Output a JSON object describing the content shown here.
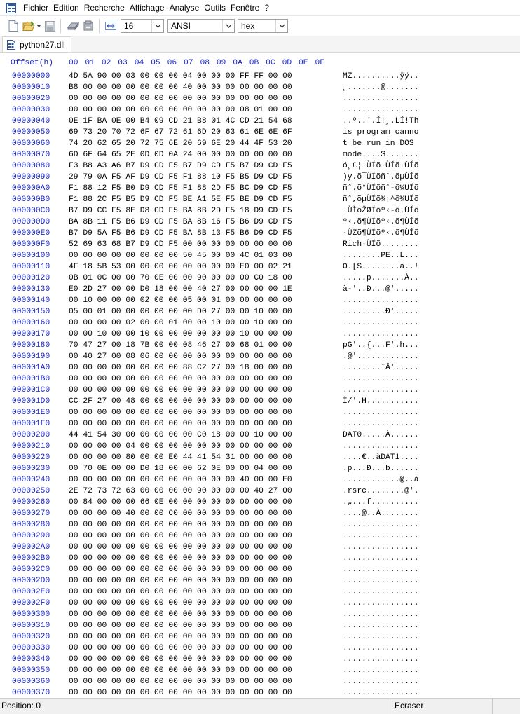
{
  "menu": [
    "Fichier",
    "Edition",
    "Recherche",
    "Affichage",
    "Analyse",
    "Outils",
    "Fenêtre",
    "?"
  ],
  "toolbar": {
    "bytes_per_row": "16",
    "charset": "ANSI",
    "display_mode": "hex"
  },
  "tab": {
    "label": "python27.dll"
  },
  "hexview": {
    "offset_label": "Offset(h)",
    "columns": [
      "00",
      "01",
      "02",
      "03",
      "04",
      "05",
      "06",
      "07",
      "08",
      "09",
      "0A",
      "0B",
      "0C",
      "0D",
      "0E",
      "0F"
    ],
    "rows": [
      {
        "off": "00000000",
        "hex": "4D 5A 90 00 03 00 00 00 04 00 00 00 FF FF 00 00",
        "asc": "MZ..........ÿÿ.."
      },
      {
        "off": "00000010",
        "hex": "B8 00 00 00 00 00 00 00 40 00 00 00 00 00 00 00",
        "asc": "¸.......@......."
      },
      {
        "off": "00000020",
        "hex": "00 00 00 00 00 00 00 00 00 00 00 00 00 00 00 00",
        "asc": "................"
      },
      {
        "off": "00000030",
        "hex": "00 00 00 00 00 00 00 00 00 00 00 00 08 01 00 00",
        "asc": "................"
      },
      {
        "off": "00000040",
        "hex": "0E 1F BA 0E 00 B4 09 CD 21 B8 01 4C CD 21 54 68",
        "asc": "..º..´.Í!¸.LÍ!Th"
      },
      {
        "off": "00000050",
        "hex": "69 73 20 70 72 6F 67 72 61 6D 20 63 61 6E 6E 6F",
        "asc": "is program canno"
      },
      {
        "off": "00000060",
        "hex": "74 20 62 65 20 72 75 6E 20 69 6E 20 44 4F 53 20",
        "asc": "t be run in DOS "
      },
      {
        "off": "00000070",
        "hex": "6D 6F 64 65 2E 0D 0D 0A 24 00 00 00 00 00 00 00",
        "asc": "mode....$......."
      },
      {
        "off": "00000080",
        "hex": "F3 B8 A3 A6 B7 D9 CD F5 B7 D9 CD F5 B7 D9 CD F5",
        "asc": "ó¸£¦·ÙÍõ·ÙÍõ·ÙÍõ"
      },
      {
        "off": "00000090",
        "hex": "29 79 0A F5 AF D9 CD F5 F1 88 10 F5 B5 D9 CD F5",
        "asc": ")y.õ¯ÙÍõñˆ.õµÙÍõ"
      },
      {
        "off": "000000A0",
        "hex": "F1 88 12 F5 B0 D9 CD F5 F1 88 2D F5 BC D9 CD F5",
        "asc": "ñˆ.õ°ÙÍõñˆ-õ¼ÙÍõ"
      },
      {
        "off": "000000B0",
        "hex": "F1 88 2C F5 B5 D9 CD F5 BE A1 5E F5 BE D9 CD F5",
        "asc": "ñˆ,õµÙÍõ¾¡^õ¾ÙÍõ"
      },
      {
        "off": "000000C0",
        "hex": "B7 D9 CC F5 8E D8 CD F5 BA 8B 2D F5 18 D9 CD F5",
        "asc": "·ÙÌõŽØÍõº‹-õ.ÙÍõ"
      },
      {
        "off": "000000D0",
        "hex": "BA 8B 11 F5 B6 D9 CD F5 BA 8B 16 F5 B6 D9 CD F5",
        "asc": "º‹.õ¶ÙÍõº‹.õ¶ÙÍõ"
      },
      {
        "off": "000000E0",
        "hex": "B7 D9 5A F5 B6 D9 CD F5 BA 8B 13 F5 B6 D9 CD F5",
        "asc": "·ÙZõ¶ÙÍõº‹.õ¶ÙÍõ"
      },
      {
        "off": "000000F0",
        "hex": "52 69 63 68 B7 D9 CD F5 00 00 00 00 00 00 00 00",
        "asc": "Rich·ÙÍõ........"
      },
      {
        "off": "00000100",
        "hex": "00 00 00 00 00 00 00 00 50 45 00 00 4C 01 03 00",
        "asc": "........PE..L..."
      },
      {
        "off": "00000110",
        "hex": "4F 18 5B 53 00 00 00 00 00 00 00 00 E0 00 02 21",
        "asc": "O.[S........à..!"
      },
      {
        "off": "00000120",
        "hex": "0B 01 0C 00 00 70 0E 00 00 90 00 00 00 C0 18 00",
        "asc": ".....p.......À.."
      },
      {
        "off": "00000130",
        "hex": "E0 2D 27 00 00 D0 18 00 00 40 27 00 00 00 00 1E",
        "asc": "à-'..Ð...@'....."
      },
      {
        "off": "00000140",
        "hex": "00 10 00 00 00 02 00 00 05 00 01 00 00 00 00 00",
        "asc": "................"
      },
      {
        "off": "00000150",
        "hex": "05 00 01 00 00 00 00 00 00 D0 27 00 00 10 00 00",
        "asc": ".........Ð'....."
      },
      {
        "off": "00000160",
        "hex": "00 00 00 00 02 00 00 01 00 00 10 00 00 10 00 00",
        "asc": "................"
      },
      {
        "off": "00000170",
        "hex": "00 00 10 00 00 10 00 00 00 00 00 00 10 00 00 00",
        "asc": "................"
      },
      {
        "off": "00000180",
        "hex": "70 47 27 00 18 7B 00 00 08 46 27 00 68 01 00 00",
        "asc": "pG'..{...F'.h..."
      },
      {
        "off": "00000190",
        "hex": "00 40 27 00 08 06 00 00 00 00 00 00 00 00 00 00",
        "asc": ".@'............."
      },
      {
        "off": "000001A0",
        "hex": "00 00 00 00 00 00 00 00 88 C2 27 00 18 00 00 00",
        "asc": "........ˆÂ'....."
      },
      {
        "off": "000001B0",
        "hex": "00 00 00 00 00 00 00 00 00 00 00 00 00 00 00 00",
        "asc": "................"
      },
      {
        "off": "000001C0",
        "hex": "00 00 00 00 00 00 00 00 00 00 00 00 00 00 00 00",
        "asc": "................"
      },
      {
        "off": "000001D0",
        "hex": "CC 2F 27 00 48 00 00 00 00 00 00 00 00 00 00 00",
        "asc": "Ì/'.H..........."
      },
      {
        "off": "000001E0",
        "hex": "00 00 00 00 00 00 00 00 00 00 00 00 00 00 00 00",
        "asc": "................"
      },
      {
        "off": "000001F0",
        "hex": "00 00 00 00 00 00 00 00 00 00 00 00 00 00 00 00",
        "asc": "................"
      },
      {
        "off": "00000200",
        "hex": "44 41 54 30 00 00 00 00 00 C0 18 00 00 10 00 00",
        "asc": "DAT0.....À......"
      },
      {
        "off": "00000210",
        "hex": "00 00 00 00 04 00 00 00 00 00 00 00 00 00 00 00",
        "asc": "................"
      },
      {
        "off": "00000220",
        "hex": "00 00 00 00 80 00 00 E0 44 41 54 31 00 00 00 00",
        "asc": "....€..àDAT1...."
      },
      {
        "off": "00000230",
        "hex": "00 70 0E 00 00 D0 18 00 00 62 0E 00 00 04 00 00",
        "asc": ".p...Ð...b......"
      },
      {
        "off": "00000240",
        "hex": "00 00 00 00 00 00 00 00 00 00 00 00 40 00 00 E0",
        "asc": "............@..à"
      },
      {
        "off": "00000250",
        "hex": "2E 72 73 72 63 00 00 00 00 90 00 00 00 40 27 00",
        "asc": ".rsrc........@'."
      },
      {
        "off": "00000260",
        "hex": "00 84 00 00 00 66 0E 00 00 00 00 00 00 00 00 00",
        "asc": ".„...f.........."
      },
      {
        "off": "00000270",
        "hex": "00 00 00 00 40 00 00 C0 00 00 00 00 00 00 00 00",
        "asc": "....@..À........"
      },
      {
        "off": "00000280",
        "hex": "00 00 00 00 00 00 00 00 00 00 00 00 00 00 00 00",
        "asc": "................"
      },
      {
        "off": "00000290",
        "hex": "00 00 00 00 00 00 00 00 00 00 00 00 00 00 00 00",
        "asc": "................"
      },
      {
        "off": "000002A0",
        "hex": "00 00 00 00 00 00 00 00 00 00 00 00 00 00 00 00",
        "asc": "................"
      },
      {
        "off": "000002B0",
        "hex": "00 00 00 00 00 00 00 00 00 00 00 00 00 00 00 00",
        "asc": "................"
      },
      {
        "off": "000002C0",
        "hex": "00 00 00 00 00 00 00 00 00 00 00 00 00 00 00 00",
        "asc": "................"
      },
      {
        "off": "000002D0",
        "hex": "00 00 00 00 00 00 00 00 00 00 00 00 00 00 00 00",
        "asc": "................"
      },
      {
        "off": "000002E0",
        "hex": "00 00 00 00 00 00 00 00 00 00 00 00 00 00 00 00",
        "asc": "................"
      },
      {
        "off": "000002F0",
        "hex": "00 00 00 00 00 00 00 00 00 00 00 00 00 00 00 00",
        "asc": "................"
      },
      {
        "off": "00000300",
        "hex": "00 00 00 00 00 00 00 00 00 00 00 00 00 00 00 00",
        "asc": "................"
      },
      {
        "off": "00000310",
        "hex": "00 00 00 00 00 00 00 00 00 00 00 00 00 00 00 00",
        "asc": "................"
      },
      {
        "off": "00000320",
        "hex": "00 00 00 00 00 00 00 00 00 00 00 00 00 00 00 00",
        "asc": "................"
      },
      {
        "off": "00000330",
        "hex": "00 00 00 00 00 00 00 00 00 00 00 00 00 00 00 00",
        "asc": "................"
      },
      {
        "off": "00000340",
        "hex": "00 00 00 00 00 00 00 00 00 00 00 00 00 00 00 00",
        "asc": "................"
      },
      {
        "off": "00000350",
        "hex": "00 00 00 00 00 00 00 00 00 00 00 00 00 00 00 00",
        "asc": "................"
      },
      {
        "off": "00000360",
        "hex": "00 00 00 00 00 00 00 00 00 00 00 00 00 00 00 00",
        "asc": "................"
      },
      {
        "off": "00000370",
        "hex": "00 00 00 00 00 00 00 00 00 00 00 00 00 00 00 00",
        "asc": "................"
      }
    ]
  },
  "status": {
    "position": "Position: 0",
    "mode": "Ecraser"
  },
  "colors": {
    "offset_blue": "#1a27c9",
    "background": "#ffffff"
  },
  "icons": [
    "hxd-app-icon",
    "new-file-icon",
    "open-folder-icon",
    "save-icon",
    "disk-icon",
    "settings-icon",
    "bytes-per-row-icon",
    "dll-file-icon"
  ]
}
